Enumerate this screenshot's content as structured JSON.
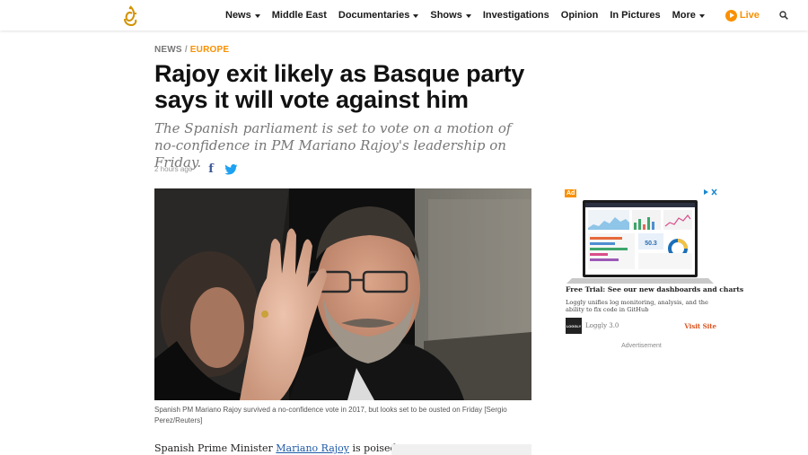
{
  "nav": {
    "items": [
      {
        "label": "News",
        "dropdown": true
      },
      {
        "label": "Middle East",
        "dropdown": false
      },
      {
        "label": "Documentaries",
        "dropdown": true
      },
      {
        "label": "Shows",
        "dropdown": true
      },
      {
        "label": "Investigations",
        "dropdown": false
      },
      {
        "label": "Opinion",
        "dropdown": false
      },
      {
        "label": "In Pictures",
        "dropdown": false
      },
      {
        "label": "More",
        "dropdown": true
      }
    ],
    "live_label": "Live"
  },
  "article": {
    "breadcrumb": {
      "section": "NEWS",
      "separator": "/",
      "category": "EUROPE"
    },
    "headline": "Rajoy exit likely as Basque party says it will vote against him",
    "subheadline": "The Spanish parliament is set to vote on a motion of no-confidence in PM Mariano Rajoy's leadership on Friday.",
    "timestamp": "2 hours ago",
    "share": {
      "facebook_glyph": "f"
    },
    "image_caption": "Spanish PM Mariano Rajoy survived a no-confidence vote in 2017, but looks set to be ousted on Friday [Sergio Perez/Reuters]",
    "body_intro": "Spanish Prime Minister ",
    "body_link": "Mariano Rajoy",
    "body_rest": " is poised to"
  },
  "ad": {
    "badge": "Ad",
    "headline": "Free Trial: See our new dashboards and charts",
    "description": "Loggly unifies log monitoring, analysis, and the ability to fix code in GitHub",
    "logo_text": "LOGGLY",
    "brand": "Loggly 3.0",
    "cta": "Visit Site",
    "dashboard_metric": "50.3",
    "label": "Advertisement"
  },
  "colors": {
    "accent": "#fa9000",
    "link": "#1f5aa6",
    "facebook": "#3b5998",
    "twitter": "#1da1f2"
  },
  "icons": [
    "aljazeera-logo",
    "search-icon",
    "play-icon",
    "facebook-icon",
    "twitter-icon",
    "adchoices-icon",
    "close-icon"
  ]
}
